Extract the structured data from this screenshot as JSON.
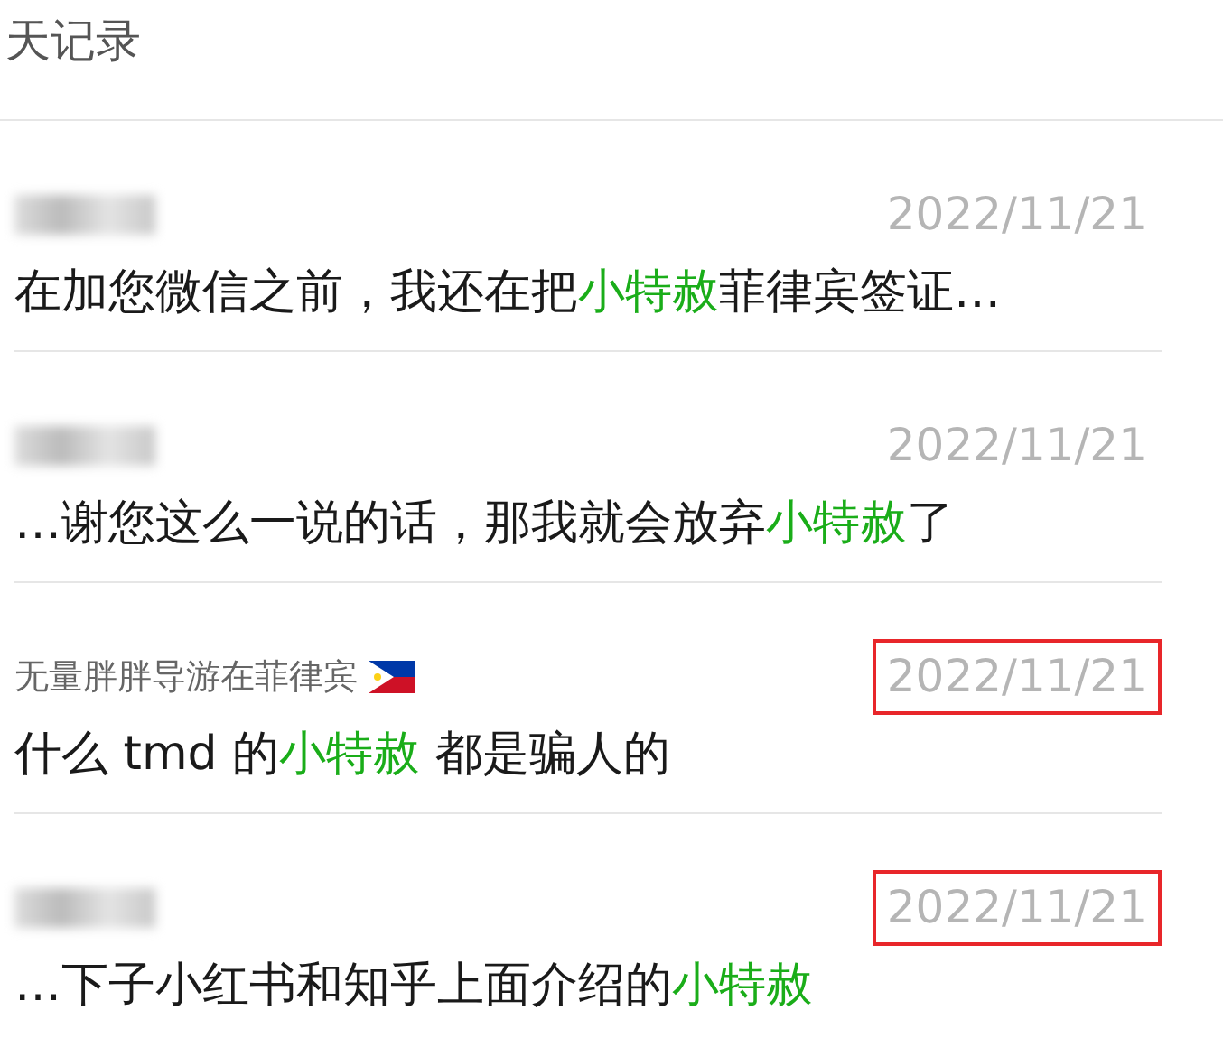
{
  "header": {
    "title": "天记录"
  },
  "results": [
    {
      "sender": {
        "kind": "blurred"
      },
      "date": "2022/11/21",
      "annotated": false,
      "message": {
        "before": "在加您微信之前，我还在把",
        "keyword": "小特赦",
        "after": "菲律宾签证…"
      }
    },
    {
      "sender": {
        "kind": "blurred"
      },
      "date": "2022/11/21",
      "annotated": false,
      "message": {
        "before": "…谢您这么一说的话，那我就会放弃",
        "keyword": "小特赦",
        "after": "了"
      }
    },
    {
      "sender": {
        "kind": "named",
        "name": "无量胖胖导游在菲律宾",
        "flag": true
      },
      "date": "2022/11/21",
      "annotated": true,
      "message": {
        "before": "什么 tmd 的",
        "keyword": "小特赦",
        "after": " 都是骗人的"
      }
    },
    {
      "sender": {
        "kind": "blurred"
      },
      "date": "2022/11/21",
      "annotated": true,
      "message": {
        "before": "…下子小红书和知乎上面介绍的",
        "keyword": "小特赦"
      }
    }
  ]
}
